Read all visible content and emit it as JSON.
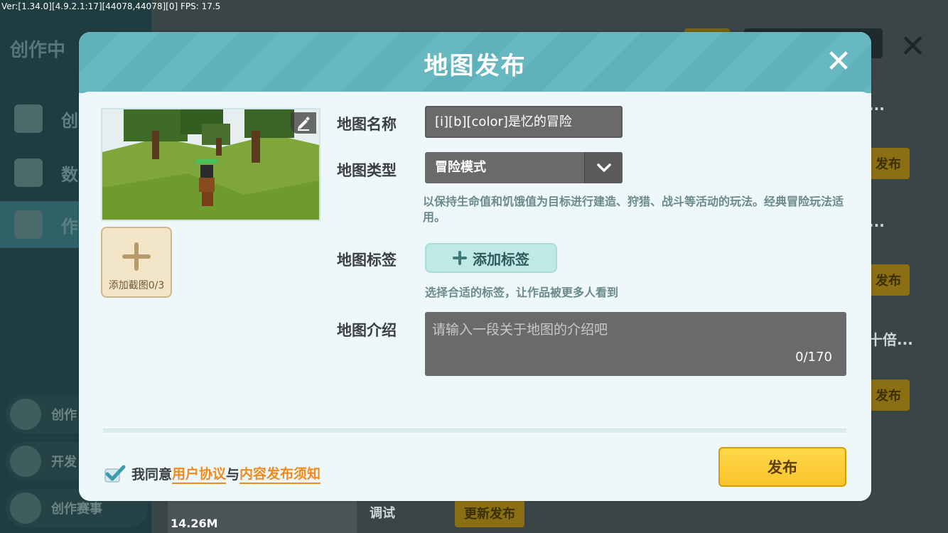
{
  "debug": {
    "text": "Ver:[1.34.0][4.9.2.1:17][44078,44078][0] FPS: 17.5"
  },
  "background": {
    "sidebar_title": "创作中",
    "nav": [
      {
        "label": "创"
      },
      {
        "label": "数"
      },
      {
        "label": "作"
      }
    ],
    "bottom_items": [
      {
        "label": "创作"
      },
      {
        "label": "开发"
      },
      {
        "label": "创作赛事"
      }
    ],
    "list_publish_labels": [
      "发布",
      "发布",
      "发布"
    ],
    "list_dots": [
      "...",
      "...",
      "十倍..."
    ],
    "thumb_size": "14.26M",
    "debug_label": "调试",
    "update_publish": "更新发布"
  },
  "modal": {
    "title": "地图发布",
    "close_icon": "close-icon",
    "fields": {
      "name_label": "地图名称",
      "name_value": "[i][b][color]是忆的冒险",
      "type_label": "地图类型",
      "type_value": "冒险模式",
      "type_description": "以保持生命值和饥饿值为目标进行建造、狩猎、战斗等活动的玩法。经典冒险玩法适用。",
      "tag_label": "地图标签",
      "tag_button": "添加标签",
      "tag_hint": "选择合适的标签，让作品被更多人看到",
      "intro_label": "地图介绍",
      "intro_placeholder": "请输入一段关于地图的介绍吧",
      "intro_counter": "0/170"
    },
    "screenshot": {
      "add_label": "添加截图0/3",
      "edit_icon": "pencil-icon"
    },
    "agreement": {
      "prefix": "我同意",
      "link1": "用户协议",
      "conj": "与",
      "link2": "内容发布须知",
      "checked": true
    },
    "publish_button": "发布"
  },
  "colors": {
    "header_teal": "#5fb1bb",
    "accent_orange": "#f08a1c",
    "publish_yellow": "#f9c42a"
  }
}
